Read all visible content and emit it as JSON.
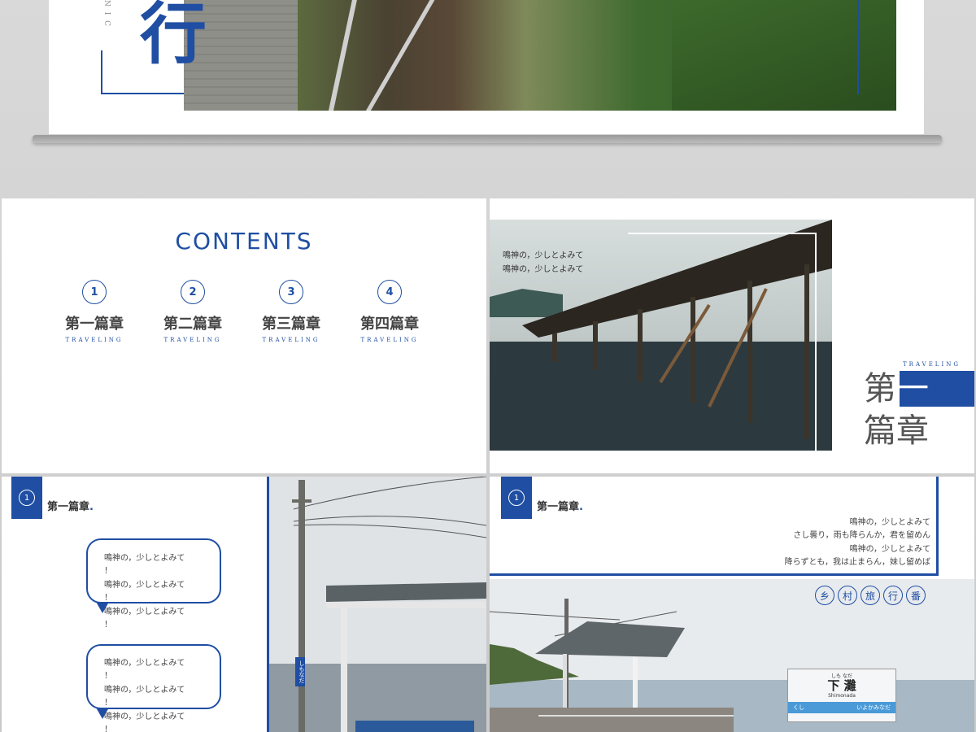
{
  "top": {
    "vertical_text": "N I C",
    "title_char_blue": "行"
  },
  "contents": {
    "title": "CONTENTS",
    "items": [
      {
        "num": "1",
        "title": "第一篇章",
        "sub": "TRAVELING"
      },
      {
        "num": "2",
        "title": "第二篇章",
        "sub": "TRAVELING"
      },
      {
        "num": "3",
        "title": "第三篇章",
        "sub": "TRAVELING"
      },
      {
        "num": "4",
        "title": "第四篇章",
        "sub": "TRAVELING"
      }
    ]
  },
  "chapter": {
    "poem_lines": [
      "鳴神の，少しとよみて",
      "鳴神の，少しとよみて"
    ],
    "sub": "TRAVELING",
    "title_part1": "第",
    "title_part2": "一",
    "title_line2": "篇章"
  },
  "bubbles_slide": {
    "num": "1",
    "heading": "第一篇章",
    "dot": ".",
    "bubble1": [
      "鳴神の，少しとよみて",
      "！",
      "鳴神の，少しとよみて",
      "！",
      "鳴神の，少しとよみて",
      "！"
    ],
    "bubble2": [
      "鳴神の，少しとよみて",
      "！",
      "鳴神の，少しとよみて",
      "！",
      "鳴神の，少しとよみて",
      "！"
    ],
    "pole_sign": "しもなだ"
  },
  "station_slide": {
    "num": "1",
    "heading": "第一篇章",
    "dot": ".",
    "poem_lines": [
      "鳴神の，少しとよみて",
      "さし曇り，雨も降らんか，君を留めん",
      "鳴神の，少しとよみて",
      "降らずとも，我は止まらん，妹し留めば"
    ],
    "tags": [
      "乡",
      "村",
      "旅",
      "行",
      "番"
    ],
    "sign_kana": "しも なだ",
    "sign_title": "下 灘",
    "sign_romaji": "Shimonada",
    "sign_left": "くし",
    "sign_right": "いよかみなだ"
  }
}
